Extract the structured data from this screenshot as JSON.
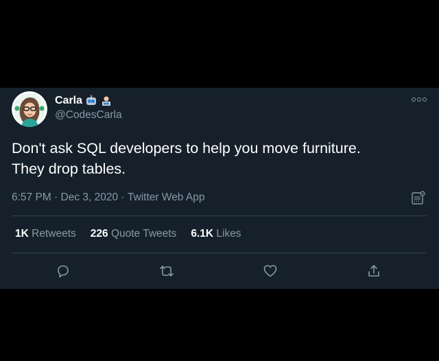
{
  "tweet": {
    "display_name": "Carla",
    "name_emojis": [
      "robot-emoji",
      "technologist-emoji"
    ],
    "handle": "@CodesCarla",
    "text_lines": [
      "Don't ask SQL developers to help you move furniture.",
      "They drop tables."
    ],
    "time": "6:57 PM",
    "date": "Dec 3, 2020",
    "source": "Twitter Web App",
    "separator": " · "
  },
  "stats": {
    "retweets": {
      "value": "1K",
      "label": "Retweets"
    },
    "quote_tweets": {
      "value": "226",
      "label": "Quote Tweets"
    },
    "likes": {
      "value": "6.1K",
      "label": "Likes"
    }
  },
  "actions": [
    "reply-icon",
    "retweet-icon",
    "like-icon",
    "share-icon"
  ],
  "colors": {
    "background": "#000000",
    "card": "#15202b",
    "text": "#ffffff",
    "secondary": "#8899a6",
    "divider": "#38444d"
  }
}
